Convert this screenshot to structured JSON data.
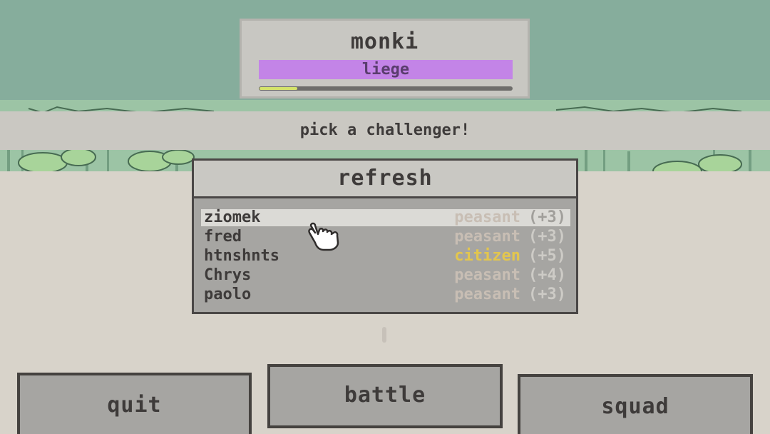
{
  "player": {
    "name": "monki",
    "rank": "liege",
    "rank_color": "#c384e7",
    "xp_progress": 0.15
  },
  "banner": {
    "text": "pick a challenger!"
  },
  "panel": {
    "refresh_label": "refresh",
    "challengers": [
      {
        "name": "ziomek",
        "rank": "peasant",
        "bonus": "(+3)",
        "selected": true
      },
      {
        "name": "fred",
        "rank": "peasant",
        "bonus": "(+3)",
        "selected": false
      },
      {
        "name": "htnshnts",
        "rank": "citizen",
        "bonus": "(+5)",
        "selected": false
      },
      {
        "name": "Chrys",
        "rank": "peasant",
        "bonus": "(+4)",
        "selected": false
      },
      {
        "name": "paolo",
        "rank": "peasant",
        "bonus": "(+3)",
        "selected": false
      }
    ]
  },
  "buttons": {
    "quit": "quit",
    "battle": "battle",
    "squad": "squad"
  },
  "colors": {
    "sky": "#86ad9c",
    "ground": "#d8d3ca",
    "citizen": "#e3c64d",
    "peasant": "#c8beb4"
  },
  "icons": {
    "cursor": "pointing-hand-icon"
  }
}
